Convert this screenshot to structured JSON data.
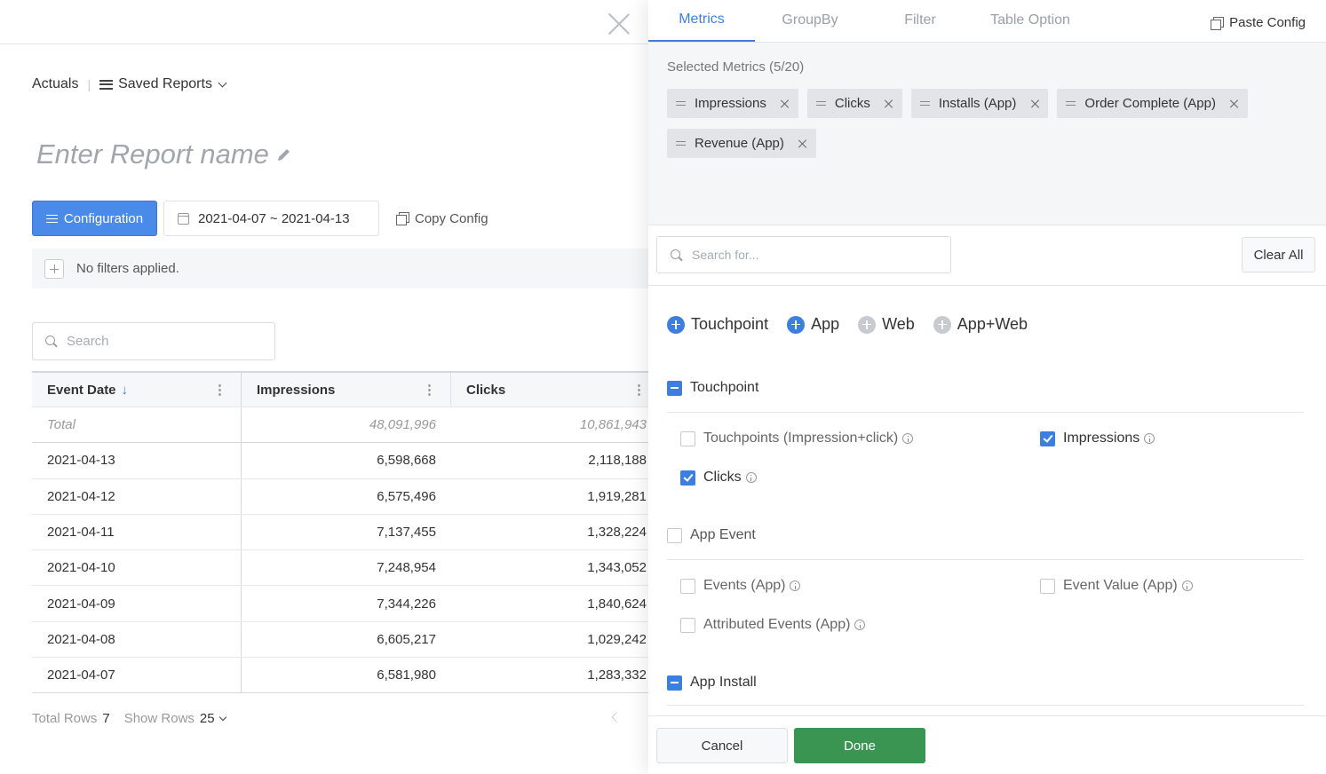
{
  "breadcrumb": {
    "actuals": "Actuals",
    "saved_reports": "Saved Reports"
  },
  "report": {
    "name_placeholder": "Enter Report name"
  },
  "toolbar": {
    "configuration": "Configuration",
    "date_range": "2021-04-07 ~ 2021-04-13",
    "copy_config": "Copy Config"
  },
  "filters": {
    "empty_text": "No filters applied."
  },
  "table_search": {
    "placeholder": "Search"
  },
  "table": {
    "columns": [
      "Event Date",
      "Impressions",
      "Clicks"
    ],
    "total": {
      "label": "Total",
      "impressions": "48,091,996",
      "clicks": "10,861,943"
    },
    "rows": [
      {
        "date": "2021-04-13",
        "impressions": "6,598,668",
        "clicks": "2,118,188"
      },
      {
        "date": "2021-04-12",
        "impressions": "6,575,496",
        "clicks": "1,919,281"
      },
      {
        "date": "2021-04-11",
        "impressions": "7,137,455",
        "clicks": "1,328,224"
      },
      {
        "date": "2021-04-10",
        "impressions": "7,248,954",
        "clicks": "1,343,052"
      },
      {
        "date": "2021-04-09",
        "impressions": "7,344,226",
        "clicks": "1,840,624"
      },
      {
        "date": "2021-04-08",
        "impressions": "6,605,217",
        "clicks": "1,029,242"
      },
      {
        "date": "2021-04-07",
        "impressions": "6,581,980",
        "clicks": "1,283,332"
      }
    ]
  },
  "footer": {
    "total_rows_label": "Total Rows",
    "total_rows": "7",
    "show_rows_label": "Show Rows",
    "show_rows": "25"
  },
  "panel": {
    "tabs": [
      "Metrics",
      "GroupBy",
      "Filter",
      "Table Option"
    ],
    "paste_config": "Paste Config",
    "selected_title": "Selected Metrics (5/20)",
    "chips": [
      "Impressions",
      "Clicks",
      "Installs (App)",
      "Order Complete (App)",
      "Revenue (App)"
    ],
    "search_placeholder": "Search for...",
    "clear_all": "Clear All",
    "categories": [
      {
        "label": "Touchpoint",
        "active": true
      },
      {
        "label": "App",
        "active": true
      },
      {
        "label": "Web",
        "active": false
      },
      {
        "label": "App+Web",
        "active": false
      }
    ],
    "sections": {
      "touchpoint": "Touchpoint",
      "touchpoints_item": "Touchpoints (Impression+click)",
      "impressions_item": "Impressions",
      "clicks_item": "Clicks",
      "app_event": "App Event",
      "events_item": "Events (App)",
      "event_value_item": "Event Value (App)",
      "attributed_item": "Attributed Events (App)",
      "app_install": "App Install"
    },
    "cancel": "Cancel",
    "done": "Done"
  },
  "colors": {
    "accent": "#3d7fe0",
    "done": "#3a9553"
  }
}
